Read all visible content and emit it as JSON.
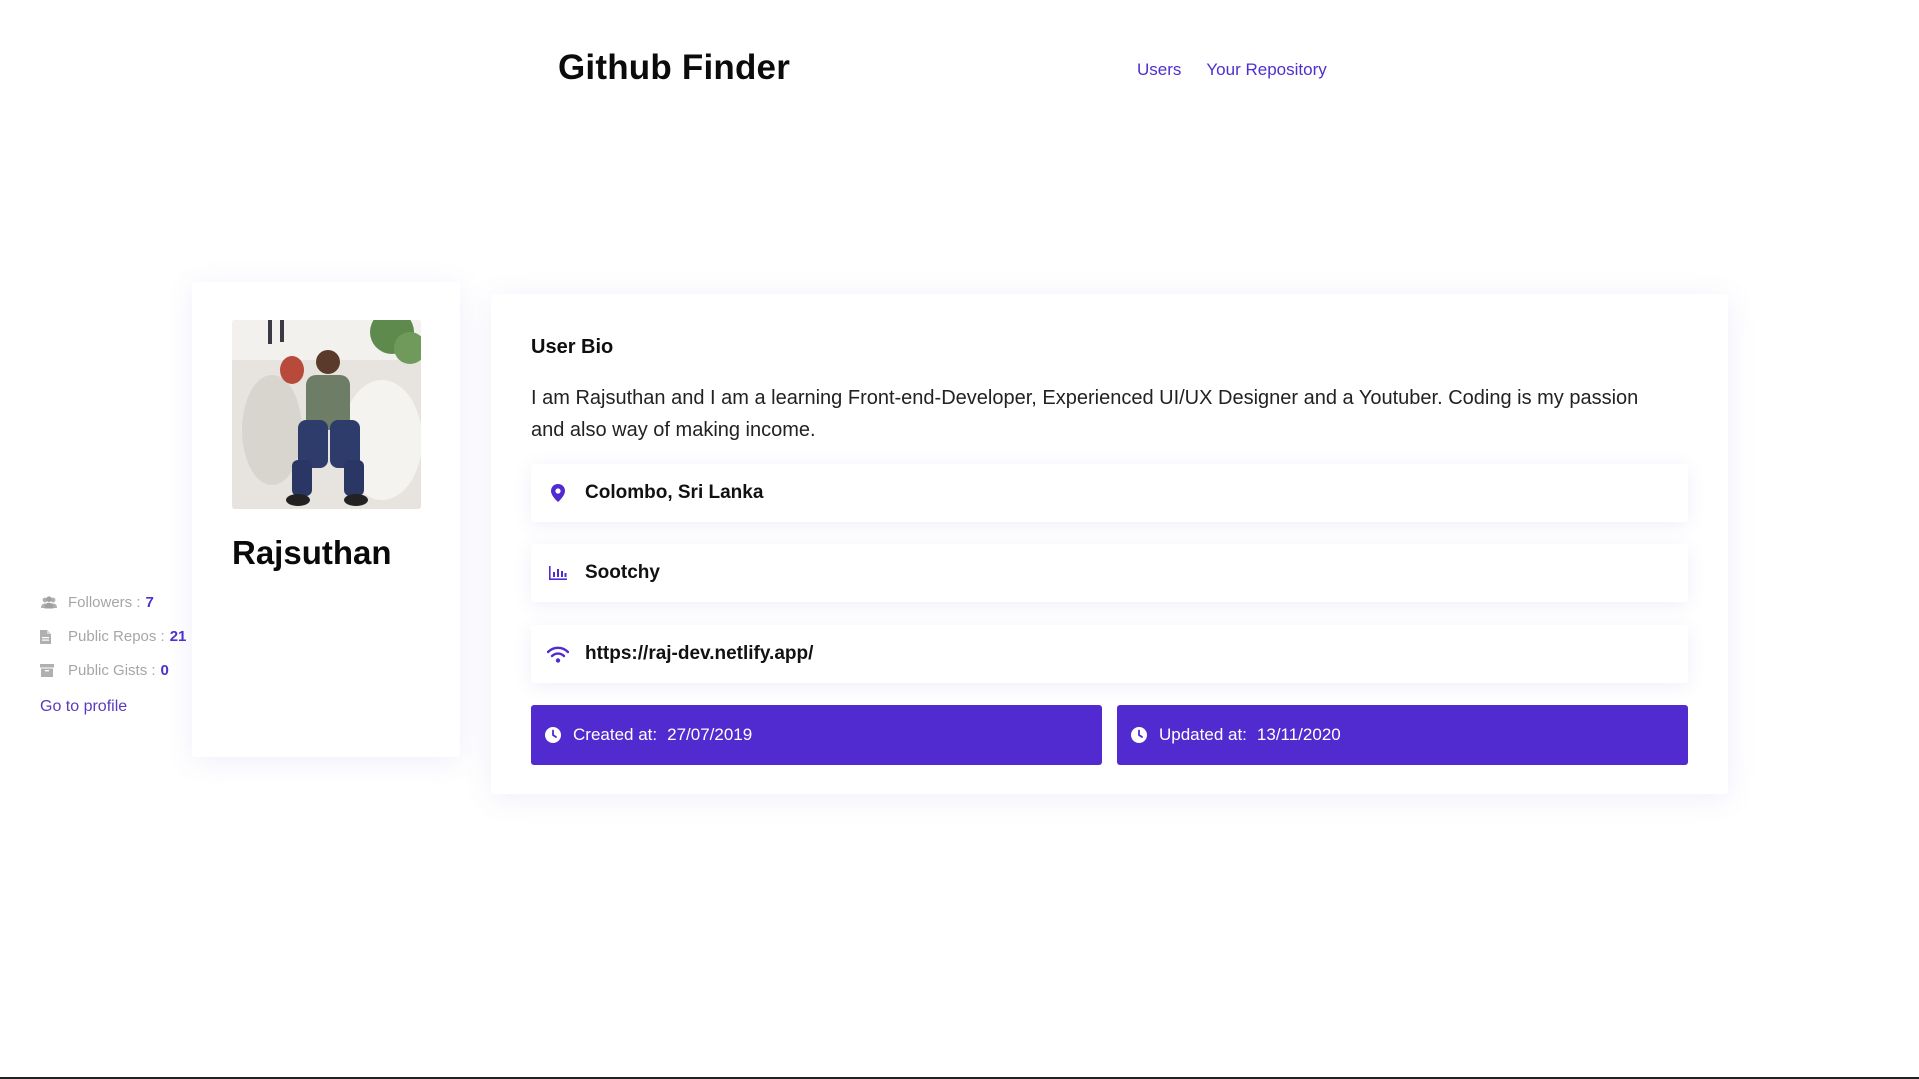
{
  "header": {
    "brand": "Github Finder",
    "nav": [
      {
        "label": "Users"
      },
      {
        "label": "Your Repository"
      }
    ]
  },
  "profile": {
    "name": "Rajsuthan",
    "followers_label": "Followers :",
    "followers": "7",
    "repos_label": "Public Repos :",
    "repos": "21",
    "gists_label": "Public Gists :",
    "gists": "0",
    "profile_link": "Go to profile"
  },
  "bio": {
    "heading": "User Bio",
    "text": "I am Rajsuthan and I am a learning Front-end-Developer, Experienced UI/UX Designer and a Youtuber. Coding is my passion and also way of making income.",
    "location": "Colombo, Sri Lanka",
    "company": "Sootchy",
    "blog": "https://raj-dev.netlify.app/",
    "created_label": "Created at:",
    "created": "27/07/2019",
    "updated_label": "Updated at:",
    "updated": "13/11/2020"
  },
  "icons": {
    "location": "map-pin-icon",
    "company": "bar-chart-icon",
    "blog": "wifi-icon",
    "clock": "clock-icon",
    "followers": "users-icon",
    "repos": "file-icon",
    "gists": "archive-icon"
  },
  "colors": {
    "accent": "#512bd0",
    "link": "#4f2fcf",
    "muted": "#a6a6a6"
  }
}
